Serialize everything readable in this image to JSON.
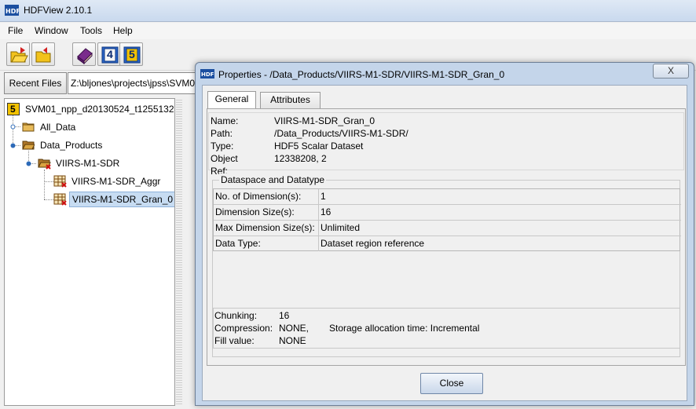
{
  "app": {
    "title": "HDFView 2.10.1",
    "logo_text": "HDF"
  },
  "menu": {
    "file": "File",
    "window": "Window",
    "tools": "Tools",
    "help": "Help"
  },
  "toolbar": {
    "buttons": [
      "open-file-icon",
      "close-file-icon",
      "help-book-icon",
      "hdf4-library-icon",
      "hdf5-library-icon"
    ],
    "hdf4_label": "4",
    "hdf5_label": "5"
  },
  "pathbar": {
    "recent_files_label": "Recent Files",
    "path_value": "Z:\\bljones\\projects\\jpss\\SVM0"
  },
  "tree": {
    "root": "SVM01_npp_d20130524_t1255132",
    "root_badge": "5",
    "nodes": [
      {
        "label": "All_Data"
      },
      {
        "label": "Data_Products"
      },
      {
        "label": "VIIRS-M1-SDR"
      },
      {
        "label": "VIIRS-M1-SDR_Aggr"
      },
      {
        "label": "VIIRS-M1-SDR_Gran_0"
      }
    ]
  },
  "dialog": {
    "title": "Properties - /Data_Products/VIIRS-M1-SDR/VIIRS-M1-SDR_Gran_0",
    "close_x": "X",
    "tabs": {
      "general": "General",
      "attributes": "Attributes"
    },
    "info": {
      "name_label": "Name:",
      "name_value": "VIIRS-M1-SDR_Gran_0",
      "path_label": "Path:",
      "path_value": "/Data_Products/VIIRS-M1-SDR/",
      "type_label": "Type:",
      "type_value": "HDF5 Scalar Dataset",
      "objref_label": "Object Ref:",
      "objref_value": "12338208, 2"
    },
    "dataspace": {
      "legend": "Dataspace and Datatype",
      "rows": [
        {
          "label": "No. of Dimension(s):",
          "value": "1"
        },
        {
          "label": "Dimension Size(s):",
          "value": "16"
        },
        {
          "label": "Max Dimension Size(s):",
          "value": "Unlimited"
        },
        {
          "label": "Data Type:",
          "value": "Dataset region reference"
        }
      ]
    },
    "storage": {
      "chunking_label": "Chunking:",
      "chunking_value": "16",
      "compression_label": "Compression:",
      "compression_value": "NONE,",
      "allocation_text": "Storage allocation time: Incremental",
      "fill_label": "Fill value:",
      "fill_value": "NONE"
    },
    "close_button": "Close"
  },
  "colors": {
    "titlebar": "#c9d9ee",
    "dialog_frame": "#c4d5ea",
    "selection": "#c7dcf2",
    "hdf5_badge": "#f2c200"
  }
}
